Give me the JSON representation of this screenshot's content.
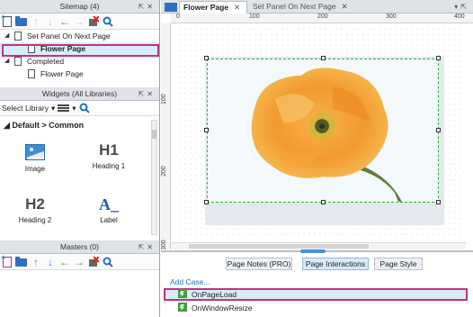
{
  "sitemap": {
    "title": "Sitemap (4)",
    "pages": [
      {
        "label": "Set Panel On Next Page",
        "level": 0,
        "expanded": true
      },
      {
        "label": "Flower Page",
        "level": 1,
        "selected": true
      },
      {
        "label": "Completed",
        "level": 0,
        "expanded": true
      },
      {
        "label": "Flower Page",
        "level": 1
      }
    ]
  },
  "widgets": {
    "title": "Widgets (All Libraries)",
    "select_label": "Select Library",
    "group": "Default > Common",
    "items": [
      {
        "label": "Image",
        "glyph": ""
      },
      {
        "label": "Heading 1",
        "glyph": "H1"
      },
      {
        "label": "Heading 2",
        "glyph": "H2"
      },
      {
        "label": "Label",
        "glyph": "A_"
      }
    ]
  },
  "masters": {
    "title": "Masters (0)"
  },
  "editor": {
    "tabs": [
      {
        "label": "Flower Page",
        "active": true
      },
      {
        "label": "Set Panel On Next Page",
        "active": false
      }
    ],
    "ruler_h": [
      "0",
      "100",
      "200",
      "300",
      "400"
    ],
    "ruler_v": [
      "100",
      "200",
      "300"
    ]
  },
  "bottom": {
    "tabs": [
      "Page Notes (PRO)",
      "Page Interactions",
      "Page Style"
    ],
    "active_tab": "Page Interactions",
    "add_case": "Add Case...",
    "events": [
      {
        "label": "OnPageLoad",
        "selected": true
      },
      {
        "label": "OnWindowResize",
        "selected": false
      }
    ]
  },
  "colors": {
    "accent": "#1f6fc8",
    "highlight": "#c2337a",
    "selection_bg": "#d9ecf7"
  }
}
